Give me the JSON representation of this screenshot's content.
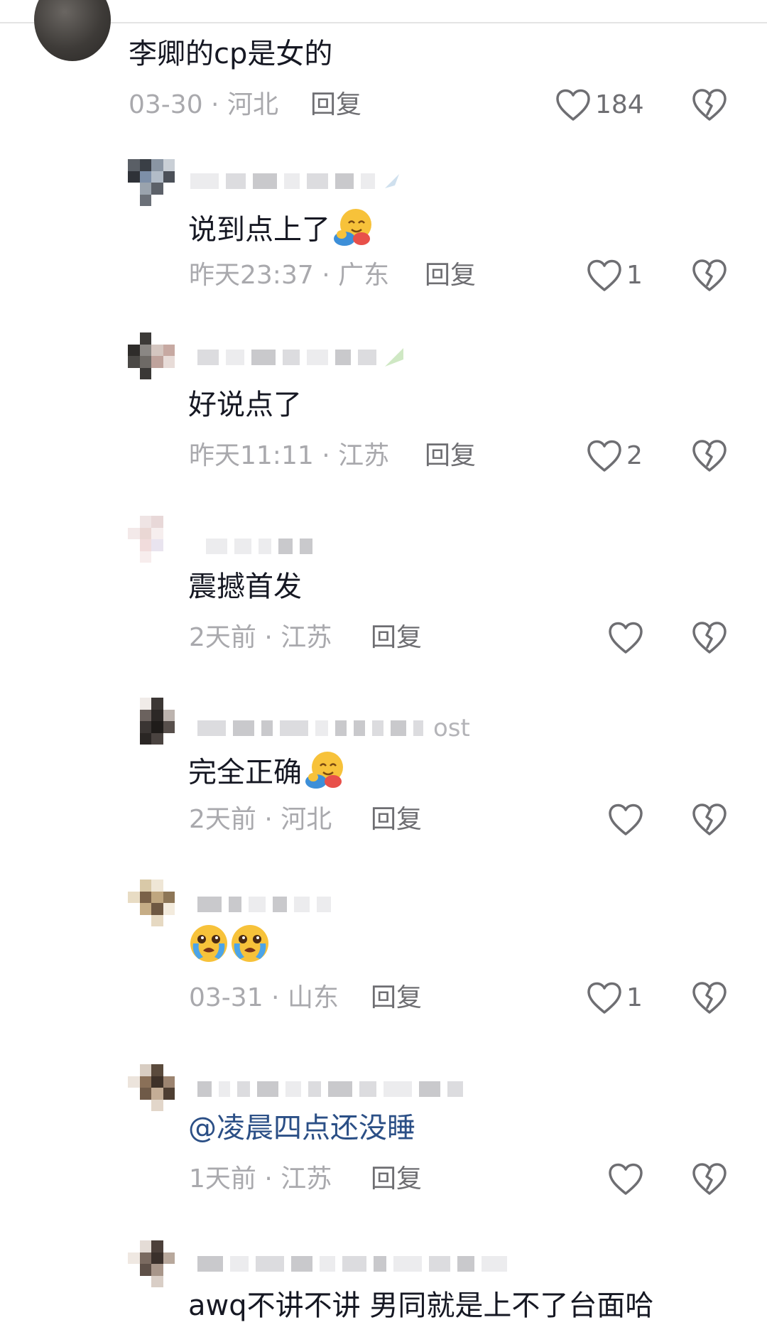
{
  "main_comment": {
    "text": "李卿的cp是女的",
    "meta": "03-30 · 河北",
    "reply_label": "回复",
    "likes": "184"
  },
  "replies": [
    {
      "text": "说到点上了",
      "emoji": "hugging-face-emoji",
      "meta": "昨天23:37 · 广东",
      "reply_label": "回复",
      "likes": "1"
    },
    {
      "text": "好说点了",
      "meta": "昨天11:11 · 江苏",
      "reply_label": "回复",
      "likes": "2"
    },
    {
      "text": "震撼首发",
      "meta": "2天前 · 江苏",
      "reply_label": "回复",
      "likes": ""
    },
    {
      "text": "完全正确",
      "emoji": "hugging-face-emoji",
      "meta": "2天前 · 河北",
      "reply_label": "回复",
      "likes": "",
      "name_suffix": "ost"
    },
    {
      "text": "",
      "emoji": "crying-face-emoji x2",
      "meta": "03-31 · 山东",
      "reply_label": "回复",
      "likes": "1"
    },
    {
      "text": "@凌晨四点还没睡",
      "meta": "1天前 · 江苏",
      "reply_label": "回复",
      "likes": ""
    },
    {
      "text": "awq不讲不讲 男同就是上不了台面哈"
    }
  ],
  "colors": {
    "text": "#161823",
    "meta": "#a9a9ad",
    "action": "#6e6e72",
    "mention": "#2b4f86"
  }
}
